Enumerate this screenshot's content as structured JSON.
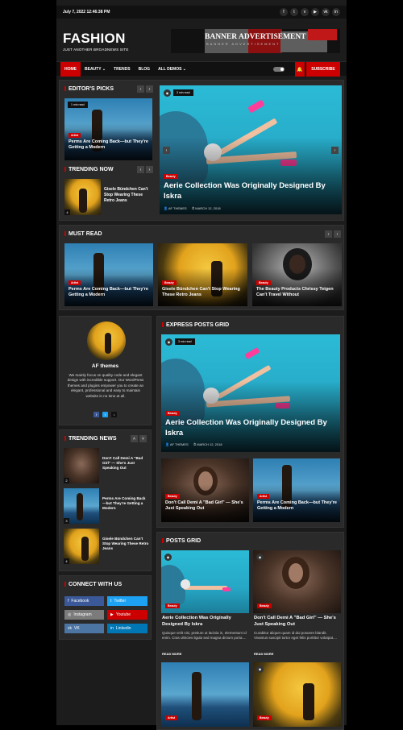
{
  "topbar": {
    "date": "July 7, 2022 12:46:38 PM",
    "social_icons": [
      "facebook-icon",
      "twitter-icon",
      "vimeo-icon",
      "youtube-icon",
      "vk-icon",
      "linkedin-icon"
    ],
    "social_glyphs": [
      "f",
      "t",
      "v",
      "▶",
      "vk",
      "in"
    ]
  },
  "brand": {
    "title": "FASHION",
    "tagline": "JUST ANOTHER BROADNEWS SITE"
  },
  "banner": {
    "title": "BANNER ADVERTISEMENT",
    "subtitle": "BANNER ADVERTISEMENT"
  },
  "nav": {
    "items": [
      "HOME",
      "BEAUTY ⌄",
      "TRENDS",
      "BLOG",
      "ALL DEMOS ⌄"
    ],
    "subscribe": "SUBSCRIBE",
    "bell": "🔔"
  },
  "arrows": {
    "prev": "‹",
    "next": "›",
    "up": "˄",
    "down": "˅"
  },
  "editors_picks": {
    "title": "EDITOR'S PICKS",
    "card": {
      "read": "1 min read",
      "cat": "Artist",
      "title": "Perms Are Coming Back—but They're Getting a Modern"
    }
  },
  "featured": {
    "read": "3 min read",
    "cat": "Beauty",
    "title": "Aerie Collection Was Originally Designed By Iskra",
    "author": "AF THEMES",
    "date": "MARCH 12, 2018"
  },
  "trending_now": {
    "title": "TRENDING NOW",
    "item": {
      "num": "4",
      "title": "Gisele Bündchen Can't Stop Wearing These Retro Jeans"
    }
  },
  "must_read": {
    "title": "MUST READ",
    "cards": [
      {
        "cat": "Artist",
        "title": "Perms Are Coming Back—but They're Getting a Modern"
      },
      {
        "cat": "Beauty",
        "title": "Gisele Bündchen Can't Stop Wearing These Retro Jeans"
      },
      {
        "cat": "Beauty",
        "title": "The Beauty Products Chrissy Teigen Can't Travel Without"
      }
    ]
  },
  "author": {
    "name": "AF themes",
    "bio": "We mainly focus on quality code and elegant design with incredible support. Our WordPress themes and plugins empower you to create an elegant, professional and easy to maintain website in no time at all.",
    "icons": [
      "f",
      "t",
      "♪"
    ]
  },
  "trending_news": {
    "title": "TRENDING NEWS",
    "items": [
      {
        "num": "2",
        "title": "Don't Call Demi A \"Bad Girl\" — She's Just Speaking Out"
      },
      {
        "num": "3",
        "title": "Perms Are Coming Back—but They're Getting a Modern"
      },
      {
        "num": "4",
        "title": "Gisele Bündchen Can't Stop Wearing These Retro Jeans"
      }
    ]
  },
  "connect": {
    "title": "CONNECT WITH US",
    "buttons": [
      {
        "label": "Facebook",
        "glyph": "f",
        "color": "#3b5998"
      },
      {
        "label": "Twitter",
        "glyph": "t",
        "color": "#1da1f2"
      },
      {
        "label": "Instagram",
        "glyph": "◎",
        "color": "#7b7b7b"
      },
      {
        "label": "Youtube",
        "glyph": "▶",
        "color": "#cc0000"
      },
      {
        "label": "VK",
        "glyph": "vk",
        "color": "#4c75a3"
      },
      {
        "label": "Linkedin",
        "glyph": "in",
        "color": "#0077b5"
      }
    ]
  },
  "express": {
    "title": "EXPRESS POSTS GRID",
    "main": {
      "read": "3 min read",
      "cat": "Beauty",
      "title": "Aerie Collection Was Originally Designed By Iskra",
      "author": "AF THEMES",
      "date": "MARCH 12, 2018"
    },
    "small": [
      {
        "cat": "Beauty",
        "title": "Don't Call Demi A \"Bad Girl\" — She's Just Speaking Out"
      },
      {
        "cat": "Artist",
        "title": "Perms Are Coming Back—but They're Getting a Modern"
      }
    ]
  },
  "posts_grid": {
    "title": "POSTS GRID",
    "posts": [
      {
        "cat": "Beauty",
        "title": "Aerie Collection Was Originally Designed By Iskra",
        "excerpt": "Quisque velit nisi, pretium ut lacinia in, elementum id enim. Cras ultricies ligula sed magna dictum porta....",
        "more": "READ MORE"
      },
      {
        "cat": "Beauty",
        "title": "Don't Call Demi A \"Bad Girl\" — She's Just Speaking Out",
        "excerpt": "Curabitur aliquet quam id dui posuere blandit. Vivamus suscipit tortor eget felis porttitor volutpat....",
        "more": "READ MORE"
      },
      {
        "cat": "Artist"
      },
      {
        "cat": "Beauty"
      }
    ]
  }
}
